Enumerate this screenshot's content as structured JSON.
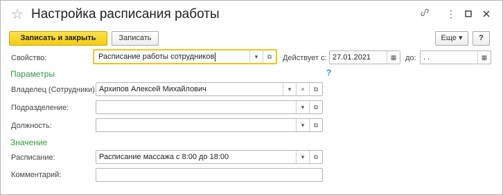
{
  "window": {
    "title": "Настройка расписания работы",
    "star": "☆",
    "link_icon": "🔗",
    "menu_icon": "⋮",
    "maximize_icon": "☐",
    "close_icon": "✕"
  },
  "toolbar": {
    "save_close_label": "Записать и закрыть",
    "save_label": "Записать",
    "more_label": "Еще ▾",
    "help_label": "?"
  },
  "form": {
    "property_label": "Свойство:",
    "property_value": "Расписание работы сотрудников",
    "valid_from_label": "Действует с:",
    "valid_from_value": "27.01.2021",
    "valid_to_label": "до:",
    "valid_to_value": " .  .",
    "params_section": "Параметры",
    "params_help": "?",
    "owner_label": "Владелец (Сотрудники):",
    "owner_value": "Архипов Алексей Михайлович",
    "department_label": "Подразделение:",
    "department_value": "",
    "position_label": "Должность:",
    "position_value": "",
    "value_section": "Значение",
    "schedule_label": "Расписание:",
    "schedule_value": "Расписание массажа с 8:00 до 18:00",
    "comment_label": "Комментарий:",
    "comment_value": ""
  },
  "icons": {
    "dropdown": "▾",
    "open": "⧉",
    "clear": "×",
    "calendar": "▦"
  }
}
